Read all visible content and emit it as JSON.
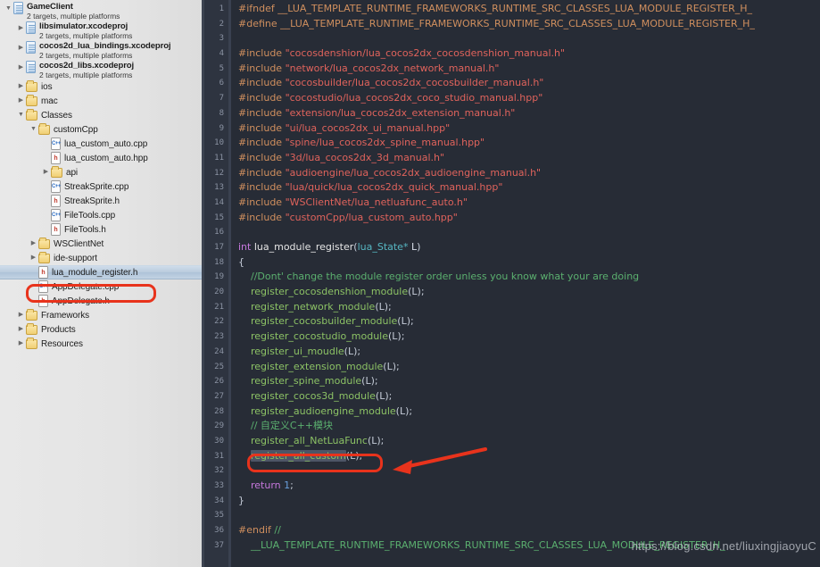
{
  "window": {
    "app": "Xcode",
    "editor_filename": "lua_module_register.h"
  },
  "sidebar": {
    "title": "Project Navigator",
    "items": [
      {
        "indent": 0,
        "twisty": "open",
        "icon": "project-icon",
        "label": "GameClient",
        "sub": "2 targets, multiple platforms",
        "selected": false
      },
      {
        "indent": 1,
        "twisty": "closed",
        "icon": "project-icon",
        "label": "libsimulator.xcodeproj",
        "sub": "2 targets, multiple platforms",
        "selected": false
      },
      {
        "indent": 1,
        "twisty": "closed",
        "icon": "project-icon",
        "label": "cocos2d_lua_bindings.xcodeproj",
        "sub": "2 targets, multiple platforms",
        "selected": false
      },
      {
        "indent": 1,
        "twisty": "closed",
        "icon": "project-icon",
        "label": "cocos2d_libs.xcodeproj",
        "sub": "2 targets, multiple platforms",
        "selected": false
      },
      {
        "indent": 1,
        "twisty": "closed",
        "icon": "folder-icon",
        "label": "ios",
        "sub": "",
        "selected": false
      },
      {
        "indent": 1,
        "twisty": "closed",
        "icon": "folder-icon",
        "label": "mac",
        "sub": "",
        "selected": false
      },
      {
        "indent": 1,
        "twisty": "open",
        "icon": "folder-icon",
        "label": "Classes",
        "sub": "",
        "selected": false
      },
      {
        "indent": 2,
        "twisty": "open",
        "icon": "folder-icon",
        "label": "customCpp",
        "sub": "",
        "selected": false
      },
      {
        "indent": 3,
        "twisty": "blank",
        "icon": "cpp-file-icon",
        "label": "lua_custom_auto.cpp",
        "sub": "",
        "selected": false
      },
      {
        "indent": 3,
        "twisty": "blank",
        "icon": "h-file-icon",
        "label": "lua_custom_auto.hpp",
        "sub": "",
        "selected": false
      },
      {
        "indent": 3,
        "twisty": "closed",
        "icon": "folder-icon",
        "label": "api",
        "sub": "",
        "selected": false
      },
      {
        "indent": 3,
        "twisty": "blank",
        "icon": "cpp-file-icon",
        "label": "StreakSprite.cpp",
        "sub": "",
        "selected": false
      },
      {
        "indent": 3,
        "twisty": "blank",
        "icon": "h-file-icon",
        "label": "StreakSprite.h",
        "sub": "",
        "selected": false
      },
      {
        "indent": 3,
        "twisty": "blank",
        "icon": "cpp-file-icon",
        "label": "FileTools.cpp",
        "sub": "",
        "selected": false
      },
      {
        "indent": 3,
        "twisty": "blank",
        "icon": "h-file-icon",
        "label": "FileTools.h",
        "sub": "",
        "selected": false
      },
      {
        "indent": 2,
        "twisty": "closed",
        "icon": "folder-icon",
        "label": "WSClientNet",
        "sub": "",
        "selected": false
      },
      {
        "indent": 2,
        "twisty": "closed",
        "icon": "folder-icon",
        "label": "ide-support",
        "sub": "",
        "selected": false
      },
      {
        "indent": 2,
        "twisty": "blank",
        "icon": "h-file-icon",
        "label": "lua_module_register.h",
        "sub": "",
        "selected": true
      },
      {
        "indent": 2,
        "twisty": "blank",
        "icon": "cpp-file-icon",
        "label": "AppDelegate.cpp",
        "sub": "",
        "selected": false
      },
      {
        "indent": 2,
        "twisty": "blank",
        "icon": "h-file-icon",
        "label": "AppDelegate.h",
        "sub": "",
        "selected": false
      },
      {
        "indent": 1,
        "twisty": "closed",
        "icon": "folder-icon",
        "label": "Frameworks",
        "sub": "",
        "selected": false
      },
      {
        "indent": 1,
        "twisty": "closed",
        "icon": "folder-icon",
        "label": "Products",
        "sub": "",
        "selected": false
      },
      {
        "indent": 1,
        "twisty": "closed",
        "icon": "folder-icon",
        "label": "Resources",
        "sub": "",
        "selected": false
      }
    ]
  },
  "editor": {
    "first_line": 1,
    "last_line": 37,
    "guard_macro": "__LUA_TEMPLATE_RUNTIME_FRAMEWORKS_RUNTIME_SRC_CLASSES_LUA_MODULE_REGISTER_H_",
    "lines": [
      {
        "n": 1,
        "tokens": [
          {
            "t": "pre",
            "v": "#ifndef "
          },
          {
            "t": "pre",
            "v": "__LUA_TEMPLATE_RUNTIME_FRAMEWORKS_RUNTIME_SRC_CLASSES_LUA_MODULE_REGISTER_H_"
          }
        ]
      },
      {
        "n": 2,
        "tokens": [
          {
            "t": "pre",
            "v": "#define "
          },
          {
            "t": "pre",
            "v": "__LUA_TEMPLATE_RUNTIME_FRAMEWORKS_RUNTIME_SRC_CLASSES_LUA_MODULE_REGISTER_H_"
          }
        ]
      },
      {
        "n": 3,
        "tokens": []
      },
      {
        "n": 4,
        "tokens": [
          {
            "t": "pre",
            "v": "#include "
          },
          {
            "t": "str",
            "v": "\"cocosdenshion/lua_cocos2dx_cocosdenshion_manual.h\""
          }
        ]
      },
      {
        "n": 5,
        "tokens": [
          {
            "t": "pre",
            "v": "#include "
          },
          {
            "t": "str",
            "v": "\"network/lua_cocos2dx_network_manual.h\""
          }
        ]
      },
      {
        "n": 6,
        "tokens": [
          {
            "t": "pre",
            "v": "#include "
          },
          {
            "t": "str",
            "v": "\"cocosbuilder/lua_cocos2dx_cocosbuilder_manual.h\""
          }
        ]
      },
      {
        "n": 7,
        "tokens": [
          {
            "t": "pre",
            "v": "#include "
          },
          {
            "t": "str",
            "v": "\"cocostudio/lua_cocos2dx_coco_studio_manual.hpp\""
          }
        ]
      },
      {
        "n": 8,
        "tokens": [
          {
            "t": "pre",
            "v": "#include "
          },
          {
            "t": "str",
            "v": "\"extension/lua_cocos2dx_extension_manual.h\""
          }
        ]
      },
      {
        "n": 9,
        "tokens": [
          {
            "t": "pre",
            "v": "#include "
          },
          {
            "t": "str",
            "v": "\"ui/lua_cocos2dx_ui_manual.hpp\""
          }
        ]
      },
      {
        "n": 10,
        "tokens": [
          {
            "t": "pre",
            "v": "#include "
          },
          {
            "t": "str",
            "v": "\"spine/lua_cocos2dx_spine_manual.hpp\""
          }
        ]
      },
      {
        "n": 11,
        "tokens": [
          {
            "t": "pre",
            "v": "#include "
          },
          {
            "t": "str",
            "v": "\"3d/lua_cocos2dx_3d_manual.h\""
          }
        ]
      },
      {
        "n": 12,
        "tokens": [
          {
            "t": "pre",
            "v": "#include "
          },
          {
            "t": "str",
            "v": "\"audioengine/lua_cocos2dx_audioengine_manual.h\""
          }
        ]
      },
      {
        "n": 13,
        "tokens": [
          {
            "t": "pre",
            "v": "#include "
          },
          {
            "t": "str",
            "v": "\"lua/quick/lua_cocos2dx_quick_manual.hpp\""
          }
        ]
      },
      {
        "n": 14,
        "tokens": [
          {
            "t": "pre",
            "v": "#include "
          },
          {
            "t": "str",
            "v": "\"WSClientNet/lua_netluafunc_auto.h\""
          }
        ]
      },
      {
        "n": 15,
        "tokens": [
          {
            "t": "pre",
            "v": "#include "
          },
          {
            "t": "str",
            "v": "\"customCpp/lua_custom_auto.hpp\""
          }
        ]
      },
      {
        "n": 16,
        "tokens": []
      },
      {
        "n": 17,
        "tokens": [
          {
            "t": "kw",
            "v": "int "
          },
          {
            "t": "fn",
            "v": "lua_module_register"
          },
          {
            "t": "punc",
            "v": "("
          },
          {
            "t": "type",
            "v": "lua_State*"
          },
          {
            "t": "plain",
            "v": " L"
          },
          {
            "t": "punc",
            "v": ")"
          }
        ]
      },
      {
        "n": 18,
        "tokens": [
          {
            "t": "punc",
            "v": "{"
          }
        ]
      },
      {
        "n": 19,
        "tokens": [
          {
            "t": "cmt",
            "v": "    //Dont' change the module register order unless you know what your are doing"
          }
        ]
      },
      {
        "n": 20,
        "tokens": [
          {
            "t": "plain",
            "v": "    "
          },
          {
            "t": "call",
            "v": "register_cocosdenshion_module"
          },
          {
            "t": "punc",
            "v": "(L);"
          }
        ]
      },
      {
        "n": 21,
        "tokens": [
          {
            "t": "plain",
            "v": "    "
          },
          {
            "t": "call",
            "v": "register_network_module"
          },
          {
            "t": "punc",
            "v": "(L);"
          }
        ]
      },
      {
        "n": 22,
        "tokens": [
          {
            "t": "plain",
            "v": "    "
          },
          {
            "t": "call",
            "v": "register_cocosbuilder_module"
          },
          {
            "t": "punc",
            "v": "(L);"
          }
        ]
      },
      {
        "n": 23,
        "tokens": [
          {
            "t": "plain",
            "v": "    "
          },
          {
            "t": "call",
            "v": "register_cocostudio_module"
          },
          {
            "t": "punc",
            "v": "(L);"
          }
        ]
      },
      {
        "n": 24,
        "tokens": [
          {
            "t": "plain",
            "v": "    "
          },
          {
            "t": "call",
            "v": "register_ui_moudle"
          },
          {
            "t": "punc",
            "v": "(L);"
          }
        ]
      },
      {
        "n": 25,
        "tokens": [
          {
            "t": "plain",
            "v": "    "
          },
          {
            "t": "call",
            "v": "register_extension_module"
          },
          {
            "t": "punc",
            "v": "(L);"
          }
        ]
      },
      {
        "n": 26,
        "tokens": [
          {
            "t": "plain",
            "v": "    "
          },
          {
            "t": "call",
            "v": "register_spine_module"
          },
          {
            "t": "punc",
            "v": "(L);"
          }
        ]
      },
      {
        "n": 27,
        "tokens": [
          {
            "t": "plain",
            "v": "    "
          },
          {
            "t": "call",
            "v": "register_cocos3d_module"
          },
          {
            "t": "punc",
            "v": "(L);"
          }
        ]
      },
      {
        "n": 28,
        "tokens": [
          {
            "t": "plain",
            "v": "    "
          },
          {
            "t": "call",
            "v": "register_audioengine_module"
          },
          {
            "t": "punc",
            "v": "(L);"
          }
        ]
      },
      {
        "n": 29,
        "tokens": [
          {
            "t": "cmt",
            "v": "    // 自定义C++模块"
          }
        ]
      },
      {
        "n": 30,
        "tokens": [
          {
            "t": "plain",
            "v": "    "
          },
          {
            "t": "call",
            "v": "register_all_NetLuaFunc"
          },
          {
            "t": "punc",
            "v": "(L);"
          }
        ]
      },
      {
        "n": 31,
        "tokens": [
          {
            "t": "plain",
            "v": "    "
          },
          {
            "t": "call-sel",
            "v": "register_all_custom"
          },
          {
            "t": "punc",
            "v": "(L);"
          }
        ]
      },
      {
        "n": 32,
        "tokens": []
      },
      {
        "n": 33,
        "tokens": [
          {
            "t": "kw",
            "v": "    return "
          },
          {
            "t": "num",
            "v": "1"
          },
          {
            "t": "punc",
            "v": ";"
          }
        ]
      },
      {
        "n": 34,
        "tokens": [
          {
            "t": "punc",
            "v": "}"
          }
        ]
      },
      {
        "n": 35,
        "tokens": []
      },
      {
        "n": 36,
        "tokens": [
          {
            "t": "pre",
            "v": "#endif "
          },
          {
            "t": "cmt",
            "v": "//"
          }
        ]
      },
      {
        "n": 37,
        "tokens": [
          {
            "t": "cmt",
            "v": "    __LUA_TEMPLATE_RUNTIME_FRAMEWORKS_RUNTIME_SRC_CLASSES_LUA_MODULE_REGISTER_H_"
          }
        ]
      }
    ]
  },
  "annotations": {
    "sidebar_box_target": "lua_module_register.h",
    "code_box_target": "register_all_custom(L);",
    "arrow_color": "#e8331c",
    "box_color": "#e8331c"
  },
  "watermark": {
    "text": "https://blog.csdn.net/liuxingjiaoyuC"
  }
}
